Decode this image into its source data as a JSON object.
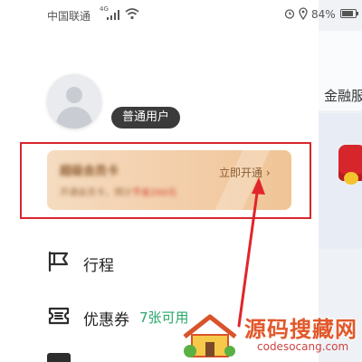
{
  "status_bar": {
    "carrier": "中国联通",
    "network_badge": "4G",
    "battery_percent": "84%",
    "battery_level": 0.84
  },
  "underlay": {
    "finance_label": "金融服"
  },
  "profile": {
    "user_level": "普通用户"
  },
  "member_card": {
    "title": "超级会员卡",
    "description": "开通会员卡，预计",
    "description_highlight": "节省200元",
    "action_label": "立即开通 ›"
  },
  "menu": {
    "items": [
      {
        "label": "行程",
        "icon": "flag-icon"
      },
      {
        "label": "优惠券",
        "icon": "coupon-icon",
        "extra": "7张可用"
      }
    ]
  },
  "watermark": {
    "title": "源码搜藏网",
    "url": "codesocang.com"
  },
  "colors": {
    "highlight_border": "#d9262d",
    "card_gradient_start": "#f5dcc0",
    "card_gradient_end": "#f0c596",
    "coupon_count": "#2aa76b",
    "user_tag_bg": "#3b3b3b"
  }
}
